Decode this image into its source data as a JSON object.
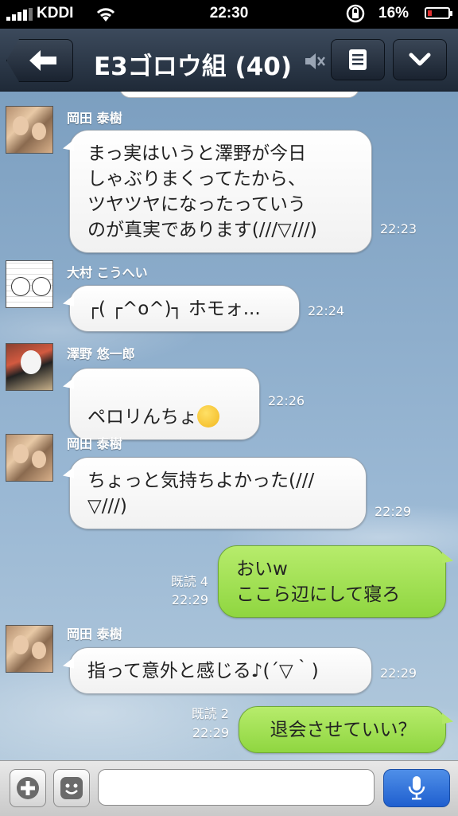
{
  "status_bar": {
    "carrier": "KDDI",
    "time": "22:30",
    "battery": "16%"
  },
  "header": {
    "title": "E3ゴロウ組 (40)",
    "icons": [
      "back-arrow-icon",
      "mute-icon",
      "menu-icon",
      "chevron-down-icon"
    ]
  },
  "messages": [
    {
      "sender": "岡田 泰樹",
      "text": "まっ実はいうと澤野が今日\nしゃぶりまくってたから、\nツヤツヤになったっていう\nのが真実であります(///▽///)",
      "time": "22:23",
      "direction": "incoming"
    },
    {
      "sender": "大村 こうへい",
      "text": "┌( ┌^o^)┐ ホモォ...",
      "time": "22:24",
      "direction": "incoming"
    },
    {
      "sender": "澤野 悠一郎",
      "text": "ペロリんちょ",
      "emoji": "smiling-face-emoji",
      "time": "22:26",
      "direction": "incoming"
    },
    {
      "sender": "岡田 泰樹",
      "text": "ちょっと気持ちよかった(///\n▽///)",
      "time": "22:29",
      "direction": "incoming"
    },
    {
      "read": "既読 4",
      "text": "おいw\nここら辺にして寝ろ",
      "time": "22:29",
      "direction": "outgoing"
    },
    {
      "sender": "岡田 泰樹",
      "text": "指って意外と感じる♪(´▽｀)",
      "time": "22:29",
      "direction": "incoming"
    },
    {
      "read": "既読 2",
      "text": "退会させていい？",
      "time": "22:29",
      "direction": "outgoing"
    }
  ],
  "input_bar": {
    "message_value": "",
    "icons": [
      "plus-icon",
      "sticker-icon",
      "microphone-icon"
    ]
  },
  "colors": {
    "header": "#2b3646",
    "outgoing_bubble": "#9fe052",
    "incoming_bubble": "#ffffff",
    "chat_background": "#8eaecb",
    "mic_button": "#2f6fd8"
  }
}
